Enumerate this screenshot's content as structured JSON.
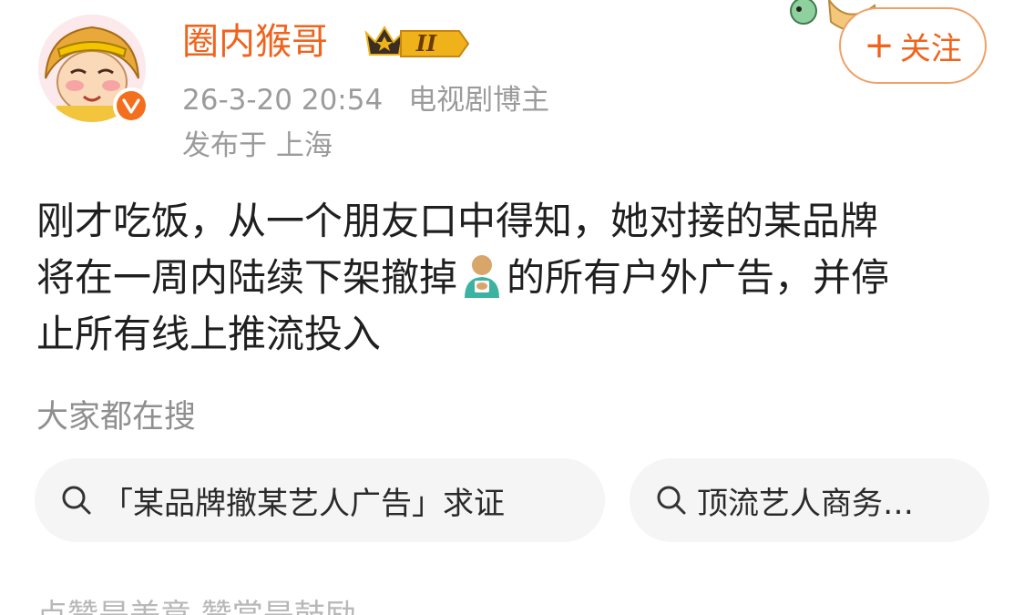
{
  "user": {
    "name": "圈内猴哥",
    "level_badge": "II",
    "post_time": "26-3-20 20:54",
    "role": "电视剧博主",
    "location": "发布于 上海"
  },
  "follow": {
    "plus": "+",
    "label": "关注"
  },
  "post": {
    "line1": "刚才吃饭，从一个朋友口中得知，她对接的某品牌",
    "line2_before": "将在一周内陆续下架撤掉",
    "line2_after": "的所有户外广告，并停",
    "line3": "止所有线上推流投入"
  },
  "search": {
    "title": "大家都在搜",
    "chips": [
      {
        "label": "「某品牌撤某艺人广告」求证"
      },
      {
        "label": "顶流艺人商务…"
      }
    ]
  },
  "bottom_partial": "点赞是美意 赞赏是鼓励",
  "colors": {
    "accent": "#f0631c",
    "meta": "#9b9b9b",
    "chip_bg": "#f5f5f5"
  },
  "icons": [
    "avatar-monkey-king",
    "verified-icon",
    "crown-level-badge",
    "search-icon",
    "emoji-icon"
  ]
}
